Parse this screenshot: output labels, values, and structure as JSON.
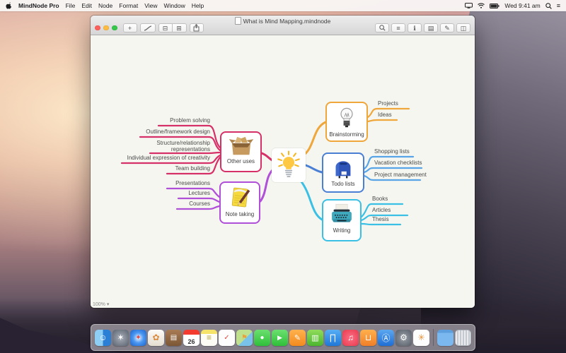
{
  "menu_bar": {
    "app_menu": "MindNode Pro",
    "menus": [
      "File",
      "Edit",
      "Node",
      "Format",
      "View",
      "Window",
      "Help"
    ],
    "status_time": "Wed 9:41 am",
    "notification_glyph": "≡"
  },
  "window": {
    "title": "What is Mind Mapping.mindnode",
    "zoom_indicator": "100%",
    "zoom_caret": "▾",
    "toolbar": {
      "add_node_glyph": "+",
      "collapse_glyph": "⊟",
      "expand_glyph": "⊞",
      "glyphs": {
        "outline": "≡",
        "info": "ℹ",
        "media": "▤",
        "style": "✎",
        "panel": "◫"
      }
    }
  },
  "mindmap": {
    "center": {
      "image": "lightbulb-yellow"
    },
    "branches": [
      {
        "label": "Brainstorming",
        "color": "#efa63b",
        "image": "lightbulb-clear",
        "children": [
          "Projects",
          "Ideas"
        ]
      },
      {
        "label": "Todo lists",
        "color": "#4a7fd4",
        "line_color": "#57a5e6",
        "image": "mailbox",
        "children": [
          "Shopping lists",
          "Vacation checklists",
          "Project management"
        ]
      },
      {
        "label": "Writing",
        "color": "#3ac0e4",
        "image": "typewriter",
        "children": [
          "Books",
          "Articles",
          "Thesis"
        ]
      },
      {
        "label": "Other uses",
        "color": "#d63069",
        "image": "cardboard-box",
        "children": [
          "Problem solving",
          "Outline/framework design",
          "Structure/relationship\nrepresentations",
          "Individual expression of creativity",
          "Team building"
        ]
      },
      {
        "label": "Note taking",
        "color": "#b04fd8",
        "image": "notepad",
        "children": [
          "Presentations",
          "Lectures",
          "Courses"
        ]
      }
    ]
  },
  "dock": {
    "items": [
      {
        "name": "finder",
        "glyph": "☺"
      },
      {
        "name": "launchpad",
        "glyph": "✶"
      },
      {
        "name": "safari",
        "glyph": "✦"
      },
      {
        "name": "photos",
        "glyph": "✿"
      },
      {
        "name": "contacts",
        "glyph": "▤"
      },
      {
        "name": "calendar",
        "glyph": "26"
      },
      {
        "name": "notes",
        "glyph": "≡"
      },
      {
        "name": "reminders",
        "glyph": "✓"
      },
      {
        "name": "maps",
        "glyph": "⚑"
      },
      {
        "name": "messages",
        "glyph": "●"
      },
      {
        "name": "facetime",
        "glyph": "▶"
      },
      {
        "name": "pages",
        "glyph": "✎"
      },
      {
        "name": "numbers",
        "glyph": "▥"
      },
      {
        "name": "keynote",
        "glyph": "∏"
      },
      {
        "name": "itunes",
        "glyph": "♫"
      },
      {
        "name": "ibooks",
        "glyph": "⊔"
      },
      {
        "name": "app-store",
        "glyph": "Ⓐ"
      },
      {
        "name": "system-preferences",
        "glyph": "⚙"
      },
      {
        "name": "mindnode",
        "glyph": "✳"
      },
      {
        "name": "downloads",
        "glyph": ""
      },
      {
        "name": "trash",
        "glyph": ""
      }
    ]
  }
}
